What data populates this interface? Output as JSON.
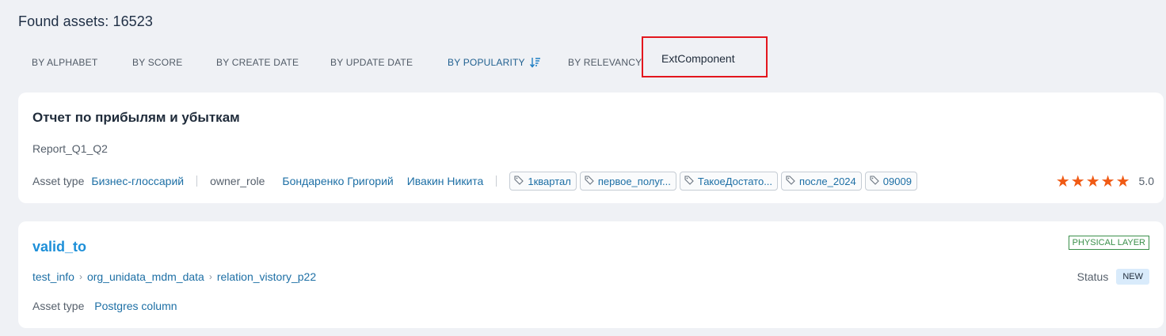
{
  "header": {
    "found_text": "Found assets: 16523"
  },
  "sort": {
    "items": [
      "BY ALPHABET",
      "BY SCORE",
      "BY CREATE DATE",
      "BY UPDATE DATE",
      "BY POPULARITY",
      "BY RELEVANCY"
    ],
    "active": "BY POPULARITY"
  },
  "ext_component": {
    "label": "ExtComponent"
  },
  "colors": {
    "accent_red": "#e3161d",
    "link": "#1d6fa5",
    "star": "#f05a14",
    "layer_green": "#3a8f4a"
  },
  "assets": [
    {
      "title": "Отчет по прибылям и убыткам",
      "subtitle": "Report_Q1_Q2",
      "asset_type_label": "Asset type",
      "asset_type": "Бизнес-глоссарий",
      "role_label": "owner_role",
      "owners": [
        "Бондаренко Григорий",
        "Ивакин Никита"
      ],
      "tags": [
        "1квартал",
        "первое_полуг...",
        "ТакоеДостато...",
        "после_2024",
        "09009"
      ],
      "rating_stars": 5,
      "rating_value": "5.0"
    },
    {
      "title": "valid_to",
      "layer": "PHYSICAL LAYER",
      "breadcrumbs": [
        "test_info",
        "org_unidata_mdm_data",
        "relation_vistory_p22"
      ],
      "status_label": "Status",
      "status": "NEW",
      "asset_type_label": "Asset type",
      "asset_type": "Postgres column"
    }
  ]
}
